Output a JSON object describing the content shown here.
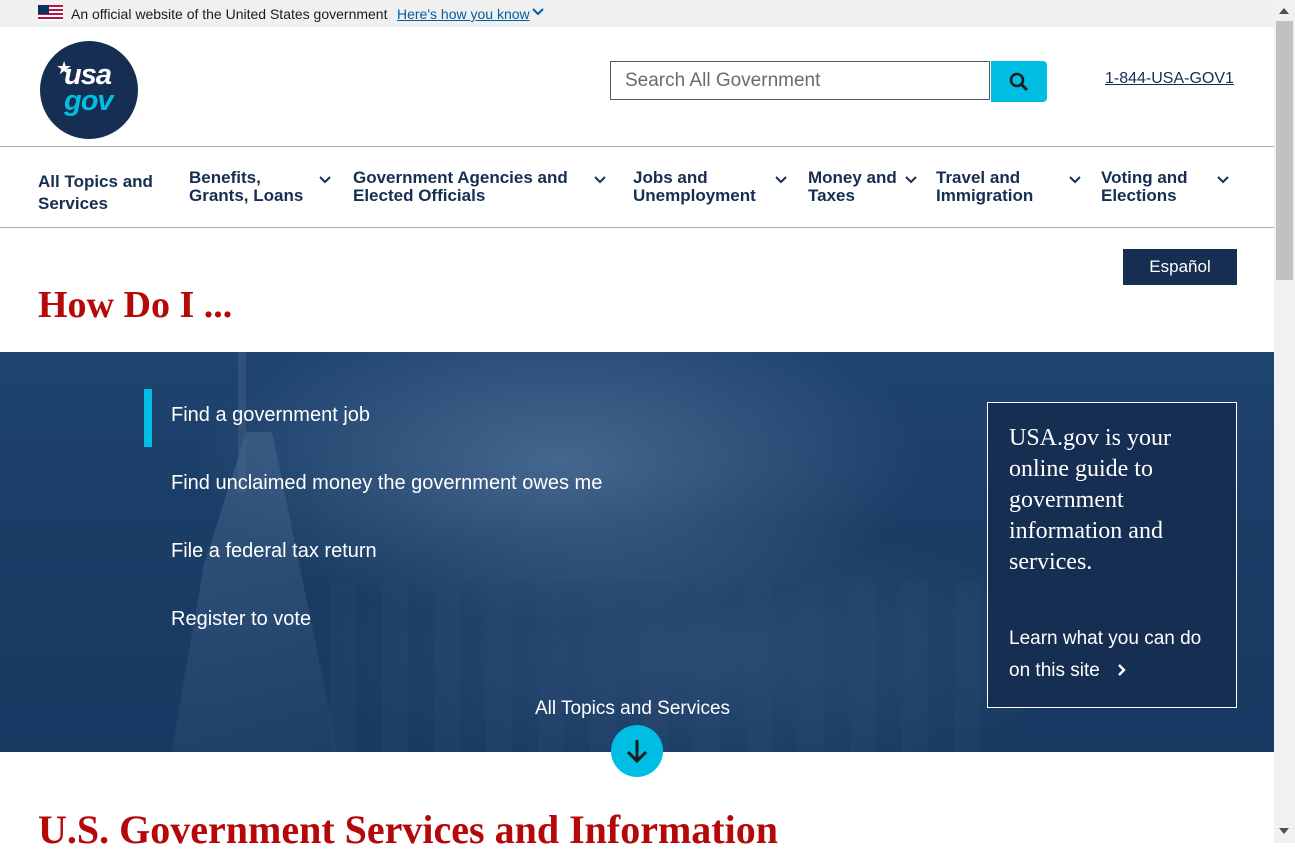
{
  "banner": {
    "official_text": "An official website of the United States government",
    "how_link": "Here's how you know"
  },
  "header": {
    "logo_top": "usa",
    "logo_bottom": "gov",
    "search_placeholder": "Search All Government",
    "phone": "1-844-USA-GOV1"
  },
  "nav": {
    "items": [
      {
        "line1": "All Topics and",
        "line2": "Services"
      },
      {
        "line1": "Benefits,",
        "line2": "Grants, Loans"
      },
      {
        "line1": "Government Agencies and",
        "line2": "Elected Officials"
      },
      {
        "line1": "Jobs and",
        "line2": "Unemployment"
      },
      {
        "line1": "Money and",
        "line2": "Taxes"
      },
      {
        "line1": "Travel and",
        "line2": "Immigration"
      },
      {
        "line1": "Voting and",
        "line2": "Elections"
      }
    ]
  },
  "language_button": "Español",
  "how_do_i": "How Do I ...",
  "hero": {
    "tasks": [
      "Find a government job",
      "Find unclaimed money the government owes me",
      "File a federal tax return",
      "Register to vote"
    ],
    "info_lead": "USA.gov is your online guide to government information and services.",
    "info_link": "Learn what you can do on this site",
    "all_topics": "All Topics and Services"
  },
  "services_title": "U.S. Government Services and Information",
  "colors": {
    "navy": "#162e51",
    "cyan": "#00bde3",
    "red_heading": "#b50909"
  }
}
